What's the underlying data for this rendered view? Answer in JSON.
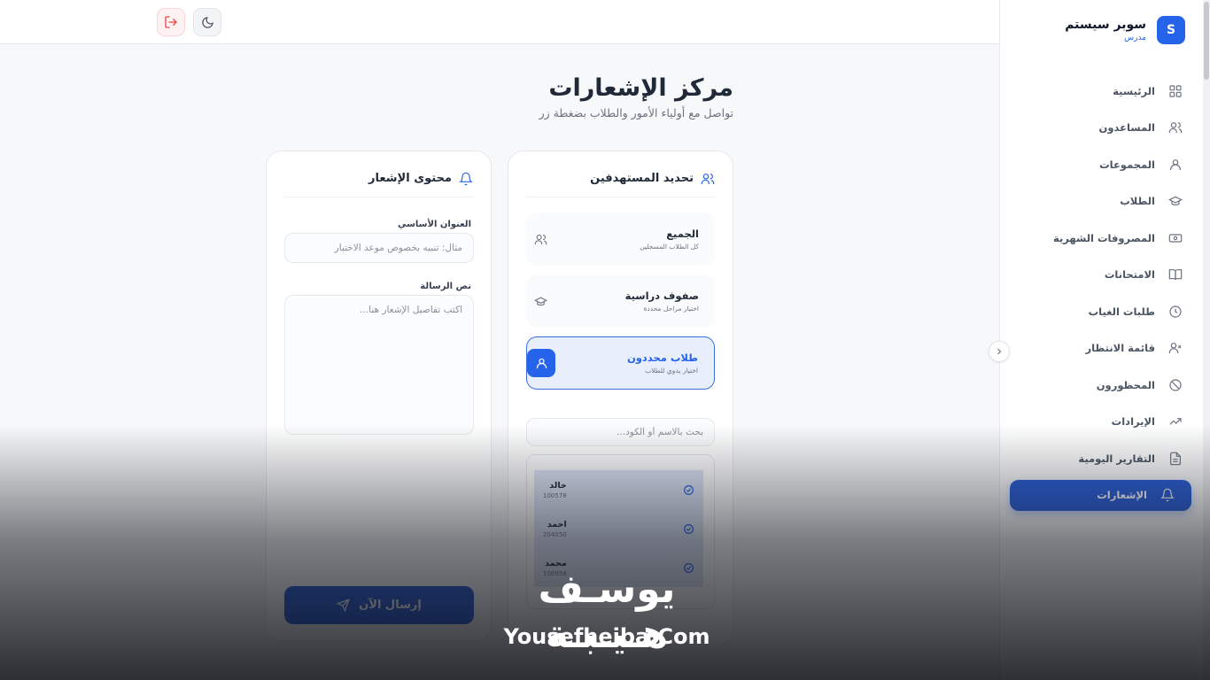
{
  "brand": {
    "logo_letter": "S",
    "name": "سوبر سيستم",
    "role": "مدرس"
  },
  "sidebar": {
    "items": [
      {
        "label": "الرئيسية",
        "icon": "dashboard-icon"
      },
      {
        "label": "المساعدون",
        "icon": "users-icon"
      },
      {
        "label": "المجموعات",
        "icon": "user-group-icon"
      },
      {
        "label": "الطلاب",
        "icon": "graduation-cap-icon"
      },
      {
        "label": "المصروفات الشهرية",
        "icon": "money-icon"
      },
      {
        "label": "الامتحانات",
        "icon": "book-icon"
      },
      {
        "label": "طلبات الغياب",
        "icon": "clock-icon"
      },
      {
        "label": "قائمة الانتظار",
        "icon": "user-x-icon"
      },
      {
        "label": "المحظورون",
        "icon": "ban-icon"
      },
      {
        "label": "الإيرادات",
        "icon": "trending-up-icon"
      },
      {
        "label": "التقارير اليومية",
        "icon": "file-text-icon"
      },
      {
        "label": "الإشعارات",
        "icon": "bell-icon",
        "active": true
      }
    ]
  },
  "header": {
    "title": "مركز الإشعارات",
    "subtitle": "تواصل مع أولياء الأمور والطلاب بضغطة زر"
  },
  "targets": {
    "title": "تحديد المستهدفين",
    "options": [
      {
        "title": "الجميع",
        "desc": "كل الطلاب المسجلين"
      },
      {
        "title": "صفوف دراسية",
        "desc": "اختيار مراحل محددة"
      },
      {
        "title": "طلاب محددون",
        "desc": "اختيار يدوي للطلاب",
        "selected": true
      }
    ],
    "search_placeholder": "بحث بالاسم أو الكود...",
    "partial_code": "100578",
    "students": [
      {
        "name": "خالد",
        "code": "100578",
        "checked": true
      },
      {
        "name": "احمد",
        "code": "204050",
        "checked": true
      },
      {
        "name": "محمد",
        "code": "100958",
        "checked": true
      }
    ]
  },
  "content": {
    "title": "محتوى الإشعار",
    "title_label": "العنوان الأساسي",
    "title_placeholder": "مثال: تنبيه بخصوص موعد الاختبار",
    "message_label": "نص الرسالة",
    "message_placeholder": "اكتب تفاصيل الإشعار هنا...",
    "send_label": "إرسال الآن"
  },
  "watermark": {
    "arabic": "يوسـف هـيـبـة",
    "english": "Yousefheiba.Com"
  },
  "colors": {
    "accent": "#2563eb",
    "danger": "#ef4444",
    "background": "#f7f8fa"
  }
}
